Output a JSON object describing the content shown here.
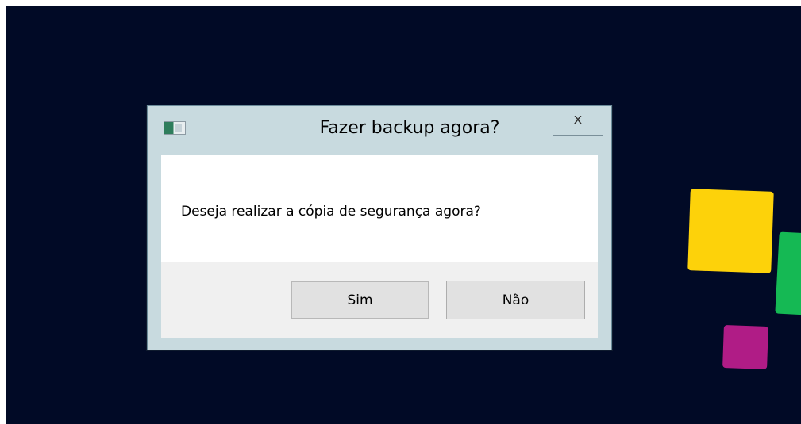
{
  "dialog": {
    "title": "Fazer backup agora?",
    "message": "Deseja realizar a cópia de segurança agora?",
    "buttons": {
      "yes": "Sim",
      "no": "Não"
    },
    "close_glyph": "x",
    "icons": {
      "app": "app-window-icon",
      "close": "close-icon"
    }
  },
  "desktop": {
    "background_color": "#010a26",
    "tile_colors": [
      "#fdd20a",
      "#15b954",
      "#b01c86"
    ]
  }
}
